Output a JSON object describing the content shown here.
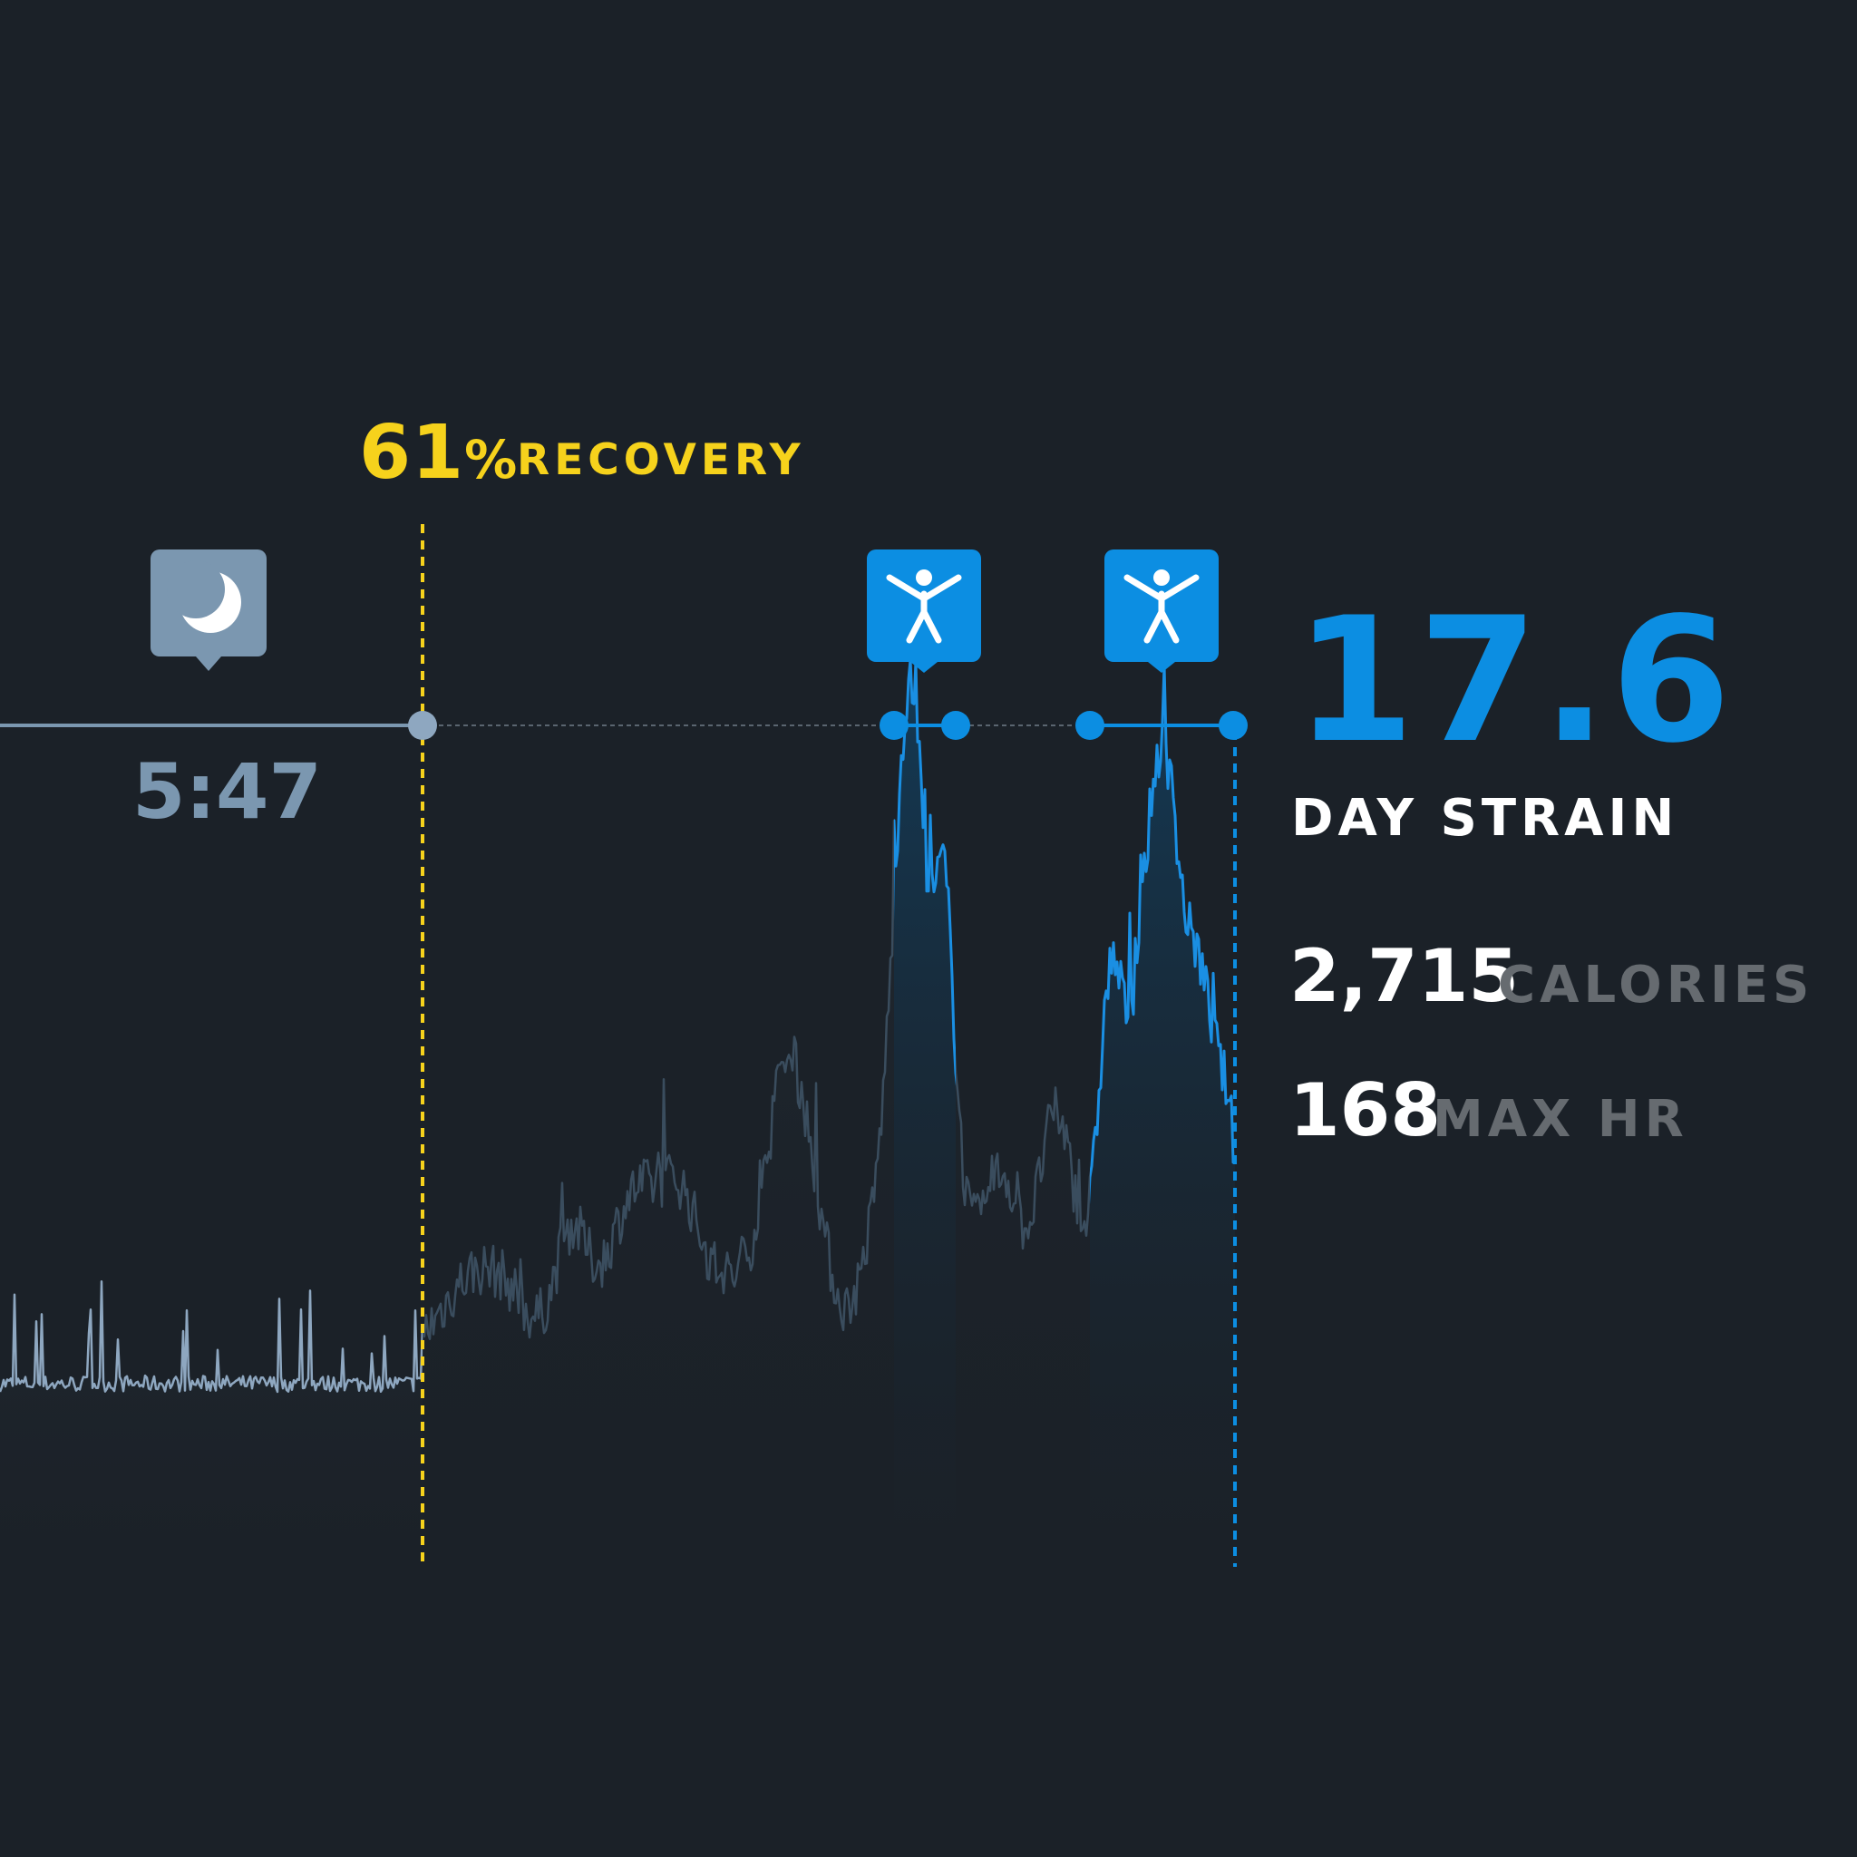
{
  "recovery": {
    "percent": "61",
    "percent_sign": "%",
    "label": "RECOVERY",
    "color": "#f6d21c"
  },
  "sleep": {
    "duration": "5:47",
    "icon": "moon-icon",
    "color": "#7b97b0"
  },
  "activities": [
    {
      "icon": "person-activity-icon"
    },
    {
      "icon": "person-activity-icon"
    }
  ],
  "strain": {
    "value": "17.6",
    "label": "DAY STRAIN",
    "color": "#0c8ee2"
  },
  "stats": {
    "calories": {
      "value": "2,715",
      "label": "CALORIES"
    },
    "max_hr": {
      "value": "168",
      "label": "MAX HR"
    }
  },
  "colors": {
    "background": "#1b2128",
    "sleep_line": "#8ea7c0",
    "day_line": "#3a4d5e",
    "activity_line": "#1a8fe3",
    "muted_text": "#666b70"
  },
  "chart_data": {
    "type": "line",
    "title": "",
    "xlabel": "",
    "ylabel": "",
    "description_segments": [
      "sleep",
      "day",
      "activity",
      "day",
      "activity"
    ],
    "series": [
      {
        "values": [
          20,
          22,
          18,
          24,
          21,
          19,
          23,
          28,
          20,
          22,
          25,
          19,
          21,
          24,
          30,
          22,
          20,
          23,
          26,
          21,
          19,
          24,
          22,
          27,
          20,
          23,
          21,
          25,
          18,
          22,
          45,
          20,
          24,
          22,
          19,
          26,
          23,
          21,
          28,
          22,
          20,
          24,
          21,
          38,
          23,
          20,
          22,
          25,
          19,
          24,
          21,
          27,
          23,
          20,
          22,
          42,
          21,
          24,
          20,
          23,
          26,
          22,
          19,
          25,
          21,
          40,
          23,
          20,
          24,
          22,
          27,
          21,
          25,
          20,
          48,
          23,
          22,
          26,
          21,
          24,
          20,
          36,
          22,
          25,
          21,
          23,
          28,
          46,
          22,
          24,
          26,
          20,
          23,
          21,
          30,
          24,
          38,
          28,
          35,
          30
        ],
        "segment": "sleep"
      }
    ]
  }
}
